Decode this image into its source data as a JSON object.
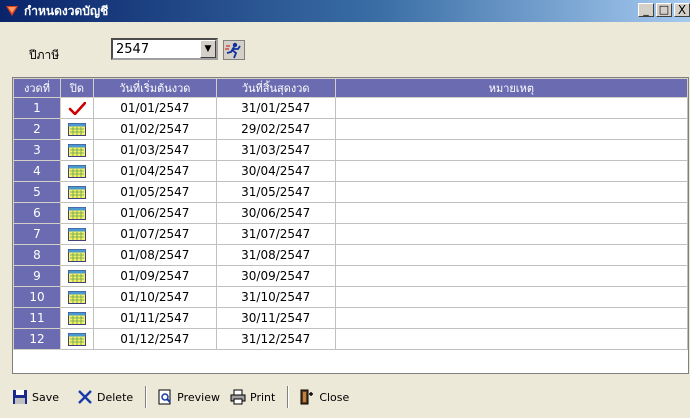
{
  "window": {
    "title": "กำหนดงวดบัญชี",
    "buttons": [
      "_",
      "□",
      "X"
    ]
  },
  "year": {
    "label": "ปีภาษี",
    "value": "2547"
  },
  "grid": {
    "columns": [
      "งวดที่",
      "ปิด",
      "วันที่เริ่มต้นงวด",
      "วันที่สิ้นสุดงวด",
      "หมายเหตุ"
    ],
    "rows": [
      {
        "no": "1",
        "closed": true,
        "start": "01/01/2547",
        "end": "31/01/2547",
        "note": ""
      },
      {
        "no": "2",
        "closed": false,
        "start": "01/02/2547",
        "end": "29/02/2547",
        "note": ""
      },
      {
        "no": "3",
        "closed": false,
        "start": "01/03/2547",
        "end": "31/03/2547",
        "note": ""
      },
      {
        "no": "4",
        "closed": false,
        "start": "01/04/2547",
        "end": "30/04/2547",
        "note": ""
      },
      {
        "no": "5",
        "closed": false,
        "start": "01/05/2547",
        "end": "31/05/2547",
        "note": ""
      },
      {
        "no": "6",
        "closed": false,
        "start": "01/06/2547",
        "end": "30/06/2547",
        "note": ""
      },
      {
        "no": "7",
        "closed": false,
        "start": "01/07/2547",
        "end": "31/07/2547",
        "note": ""
      },
      {
        "no": "8",
        "closed": false,
        "start": "01/08/2547",
        "end": "31/08/2547",
        "note": ""
      },
      {
        "no": "9",
        "closed": false,
        "start": "01/09/2547",
        "end": "30/09/2547",
        "note": ""
      },
      {
        "no": "10",
        "closed": false,
        "start": "01/10/2547",
        "end": "31/10/2547",
        "note": ""
      },
      {
        "no": "11",
        "closed": false,
        "start": "01/11/2547",
        "end": "30/11/2547",
        "note": ""
      },
      {
        "no": "12",
        "closed": false,
        "start": "01/12/2547",
        "end": "31/12/2547",
        "note": ""
      }
    ]
  },
  "toolbar": {
    "save": "Save",
    "delete": "Delete",
    "preview": "Preview",
    "print": "Print",
    "close": "Close"
  },
  "colors": {
    "header_bg": "#6b6bb2",
    "title_start": "#0a246a",
    "checkmark": "#cc0000"
  }
}
